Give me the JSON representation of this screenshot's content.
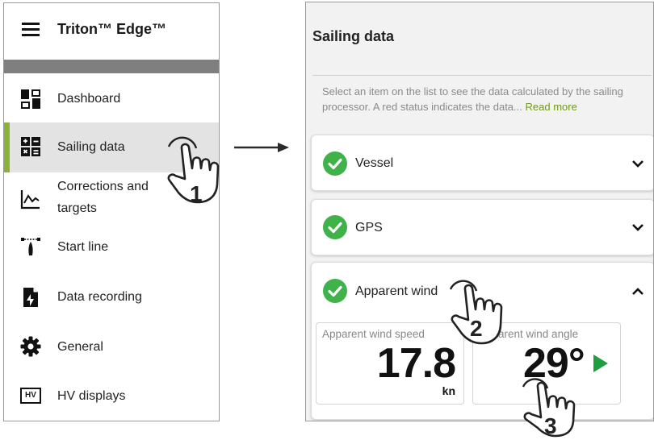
{
  "app": {
    "title": "Triton™ Edge™"
  },
  "menu": {
    "items": [
      {
        "id": "dashboard",
        "label": "Dashboard",
        "icon": "dashboard-icon"
      },
      {
        "id": "sailing",
        "label": "Sailing data",
        "icon": "sailing-data-icon",
        "active": true
      },
      {
        "id": "corrections",
        "label_line1": "Corrections and",
        "label_line2": "targets",
        "icon": "chart-icon"
      },
      {
        "id": "startline",
        "label": "Start line",
        "icon": "start-line-icon"
      },
      {
        "id": "recording",
        "label": "Data recording",
        "icon": "data-recording-icon"
      },
      {
        "id": "general",
        "label": "General",
        "icon": "gear-icon"
      },
      {
        "id": "hv",
        "label": "HV displays",
        "icon": "hv-icon",
        "icon_text": "HV"
      }
    ]
  },
  "sailing": {
    "title": "Sailing data",
    "description": "Select an item on the list to see the data calculated by the sailing processor. A red status indicates the data...",
    "read_more": "Read more",
    "sections": [
      {
        "label": "Vessel",
        "status": "ok",
        "expanded": false
      },
      {
        "label": "GPS",
        "status": "ok",
        "expanded": false
      },
      {
        "label": "Apparent wind",
        "status": "ok",
        "expanded": true
      }
    ],
    "tiles": [
      {
        "label": "Apparent wind speed",
        "value": "17.8",
        "unit": "kn"
      },
      {
        "label": "Apparent wind angle",
        "value": "29°",
        "side": "starboard"
      }
    ]
  },
  "callouts": {
    "step1": "1",
    "step2": "2",
    "step3": "3"
  },
  "colors": {
    "accent": "#8ab236",
    "status_ok": "#3fb24a",
    "starboard": "#1e9e3e",
    "band": "#7f7f7f"
  }
}
